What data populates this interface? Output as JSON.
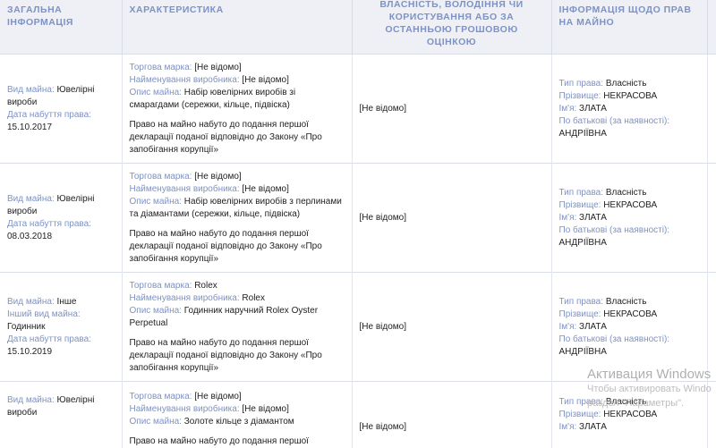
{
  "headers": {
    "general": "Загальна інформація",
    "characteristics": "Характеристика",
    "value": "власність, володіння чи користування або за останньою грошовою оцінкою",
    "rights": "Інформація щодо прав на майно"
  },
  "labels": {
    "property_type": "Вид майна:",
    "other_type": "Інший вид майна:",
    "acquired_date": "Дата набуття права:",
    "brand": "Торгова марка:",
    "manufacturer": "Найменування виробника:",
    "description": "Опис майна:",
    "right_type": "Тип права:",
    "surname": "Прізвище:",
    "name": "Ім'я:",
    "patronymic": "По батькові (за наявності):"
  },
  "rows": [
    {
      "property_type": "Ювелірні вироби",
      "acquired_date": "15.10.2017",
      "brand": "[Не відомо]",
      "manufacturer": "[Не відомо]",
      "description": "Набір ювелірних виробів зі смарагдами (сережки, кільце, підвіска)",
      "note": "Право на майно набуто до подання першої декларації поданої відповідно до Закону «Про запобігання корупції»",
      "value": "[Не відомо]",
      "right_type": "Власність",
      "surname": "НЕКРАСОВА",
      "name": "ЗЛАТА",
      "patronymic": "АНДРІЇВНА"
    },
    {
      "property_type": "Ювелірні вироби",
      "acquired_date": "08.03.2018",
      "brand": "[Не відомо]",
      "manufacturer": "[Не відомо]",
      "description": "Набір ювелірних виробів з перлинами та діамантами (сережки, кільце, підвіска)",
      "note": "Право на майно набуто до подання першої декларації поданої відповідно до Закону «Про запобігання корупції»",
      "value": "[Не відомо]",
      "right_type": "Власність",
      "surname": "НЕКРАСОВА",
      "name": "ЗЛАТА",
      "patronymic": "АНДРІЇВНА"
    },
    {
      "property_type": "Інше",
      "other_type": "Годинник",
      "acquired_date": "15.10.2019",
      "brand": "Rolex",
      "manufacturer": "Rolex",
      "description": "Годинник наручний Rolex Oyster Perpetual",
      "note": "Право на майно набуто до подання першої декларації поданої відповідно до Закону «Про запобігання корупції»",
      "value": "[Не відомо]",
      "right_type": "Власність",
      "surname": "НЕКРАСОВА",
      "name": "ЗЛАТА",
      "patronymic": "АНДРІЇВНА"
    },
    {
      "property_type": "Ювелірні вироби",
      "brand": "[Не відомо]",
      "manufacturer": "[Не відомо]",
      "description": "Золоте кільце з діамантом",
      "note": "Право на майно набуто до подання першої",
      "value": "[Не відомо]",
      "right_type": "Власність",
      "surname": "НЕКРАСОВА",
      "name": "ЗЛАТА"
    }
  ],
  "watermark": {
    "title": "Активация Windows",
    "line1": "Чтобы активировать Windo",
    "line2": "раздел \"Параметры\"."
  }
}
